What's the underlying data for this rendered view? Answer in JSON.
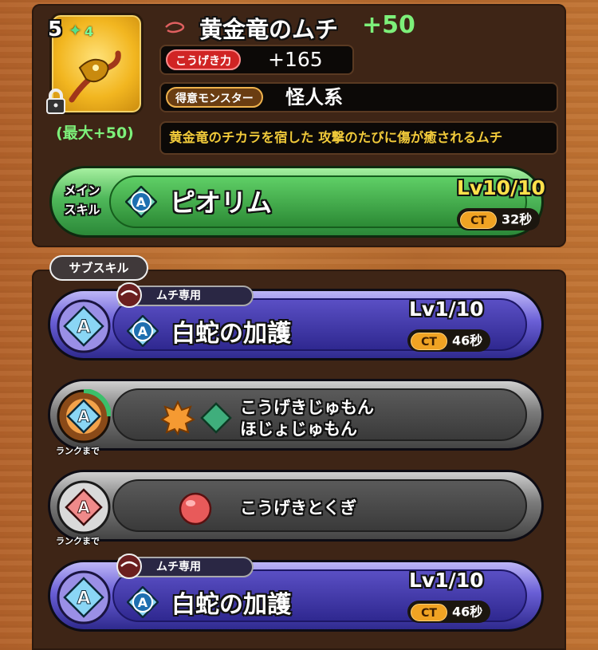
{
  "item": {
    "rank": "5",
    "sparkle_count": "4",
    "max_bonus": "(最大+50)",
    "name": "黄金竜のムチ",
    "plus": "+50",
    "attack_label": "こうげき力",
    "attack_value": "+165",
    "monster_label": "得意モンスター",
    "monster_value": "怪人系",
    "description": "黄金竜のチカラを宿した 攻撃のたびに傷が癒されるムチ"
  },
  "main_skill": {
    "label_line1": "メイン",
    "label_line2": "スキル",
    "name": "ピオリム",
    "level": "Lv10/10",
    "ct_label": "CT",
    "ct_value": "32秒",
    "skill_letter": "A"
  },
  "sub_skill_tab": "サブスキル",
  "sub_skills": [
    {
      "exclusive": "ムチ専用",
      "letter": "A",
      "name": "白蛇の加護",
      "level": "Lv1/10",
      "ct_label": "CT",
      "ct_value": "46秒"
    },
    {
      "letter": "A",
      "type_line1": "こうげきじゅもん",
      "type_line2": "ほじょじゅもん",
      "rank_label": "ランクまで"
    },
    {
      "letter": "A",
      "type_line1": "こうげきとくぎ",
      "rank_label": "ランクまで"
    },
    {
      "exclusive": "ムチ専用",
      "letter": "A",
      "name": "白蛇の加護",
      "level": "Lv1/10",
      "ct_label": "CT",
      "ct_value": "46秒"
    }
  ],
  "colors": {
    "plus_green": "#7df07a",
    "main_skill_green": "#4fb85a",
    "sub_skill_purple": "#6a5fd6",
    "ct_orange": "#f0a323",
    "desc_gold": "#f0c93a"
  },
  "icons": [
    "whip-item-icon",
    "lock-icon",
    "sparkle-icon",
    "whip-small-icon",
    "skill-a-icon",
    "orange-gear-icon",
    "green-diamond-icon",
    "red-orb-icon"
  ]
}
